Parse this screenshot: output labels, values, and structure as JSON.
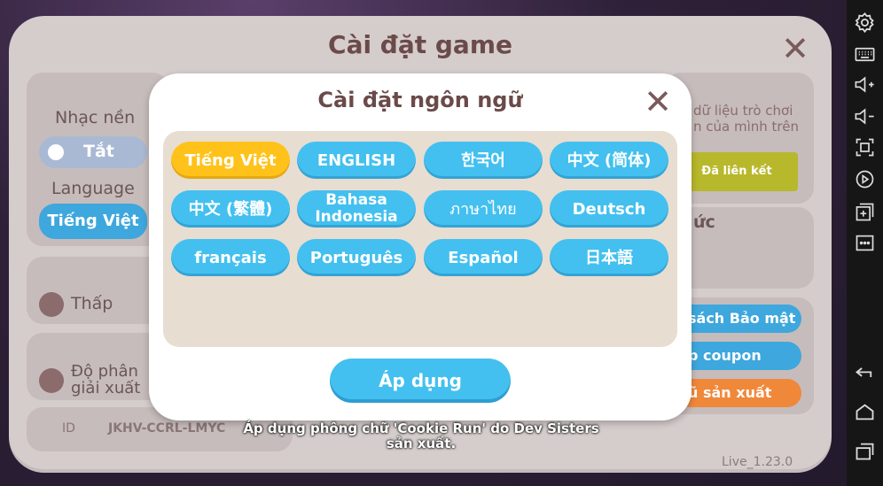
{
  "settings": {
    "title": "Cài đặt game",
    "music_label": "Nhạc nền",
    "music_toggle": "Tắt",
    "language_label": "Language",
    "language_value": "Tiếng Việt",
    "graphics_low": "Thấp",
    "resolution_label": "Độ phân giải xuất",
    "id_label": "ID",
    "id_value": "JKHV-CCRL-LMYC",
    "link_text": "dữ liệu trò chơi n của mình trên",
    "link_button": "Đã liên kết",
    "section_suffix": "ức",
    "privacy_button": "sách Bảo mật",
    "coupon_button": "p coupon",
    "producer_button": "ũ sản xuất",
    "version": "Live_1.23.0"
  },
  "language_dialog": {
    "title": "Cài đặt ngôn ngữ",
    "apply_label": "Áp dụng",
    "selected_index": 0,
    "languages": [
      "Tiếng Việt",
      "ENGLISH",
      "한국어",
      "中文 (简体)",
      "中文 (繁體)",
      "Bahasa Indonesia",
      "ภาษาไทย",
      "Deutsch",
      "français",
      "Português",
      "Español",
      "日本語"
    ]
  },
  "toast": "Áp dụng phông chữ 'Cookie Run' do Dev Sisters sản xuất.",
  "colors": {
    "accent_blue": "#43c0ef",
    "selected_yellow": "#ffc21a",
    "title_brown": "#6b4a4a",
    "panel_bg": "#d5cdcc",
    "grid_bg": "#e8ddd1"
  },
  "sidebar_icons": [
    "settings-icon",
    "keyboard-icon",
    "volume-up-icon",
    "volume-down-icon",
    "fullscreen-icon",
    "record-icon",
    "add-window-icon",
    "more-icon",
    "back-icon",
    "home-icon",
    "recent-apps-icon"
  ]
}
